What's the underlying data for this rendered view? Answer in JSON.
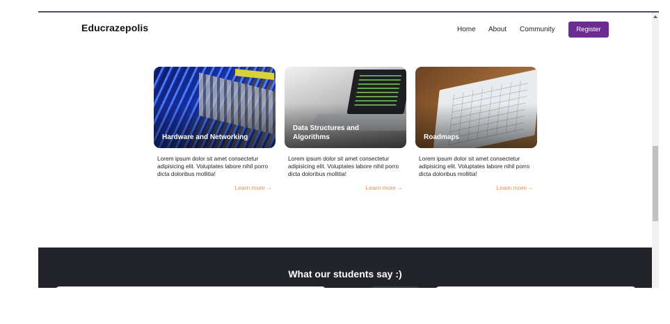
{
  "navbar": {
    "logo": "Educrazepolis",
    "links": [
      "Home",
      "About",
      "Community"
    ],
    "register_label": "Register"
  },
  "cards": [
    {
      "title": "Hardware and Networking",
      "description": "Lorem ipsum dolor sit amet consectetur adipisicing elit. Voluptates labore nihil porro dicta doloribus mollitia!",
      "link_label": "Learn more",
      "image_icon": "network-cables-photo"
    },
    {
      "title": "Data Structures and Algorithms",
      "description": "Lorem ipsum dolor sit amet consectetur adipisicing elit. Voluptates labore nihil porro dicta doloribus mollitia!",
      "link_label": "Learn more",
      "image_icon": "laptop-code-photo"
    },
    {
      "title": "Roadmaps",
      "description": "Lorem ipsum dolor sit amet consectetur adipisicing elit. Voluptates labore nihil porro dicta doloribus mollitia!",
      "link_label": "Learn more",
      "image_icon": "paper-sketch-photo"
    }
  ],
  "testimonials": {
    "heading": "What our students say :)"
  },
  "colors": {
    "accent": "#6b2c91",
    "link": "#e8905b",
    "dark_section": "#222429"
  }
}
